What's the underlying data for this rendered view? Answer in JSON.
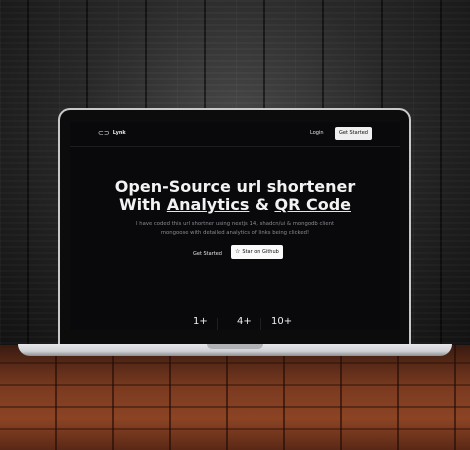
{
  "nav": {
    "logo_text": "Lynk",
    "logo_icon": "link-icon",
    "login_label": "Login",
    "cta_label": "Get Started"
  },
  "hero": {
    "title_line1": "Open-Source url shortener",
    "title_with": "With ",
    "title_analytics": "Analytics",
    "title_amp": " & ",
    "title_qr": "QR Code",
    "subtitle_line1": "I have coded this url shortner using nextjs 14, shadcn/ui & mongodb client",
    "subtitle_line2": "mongoose with detailed analytics of links being clicked!",
    "primary_button": "Get Started",
    "star_button": "Star on Github"
  },
  "stats": [
    "1+",
    "4+",
    "10+"
  ],
  "colors": {
    "screen_bg": "#09090b",
    "text": "#f2f2f2",
    "muted": "#8b8b92",
    "button_light": "#efefef"
  }
}
